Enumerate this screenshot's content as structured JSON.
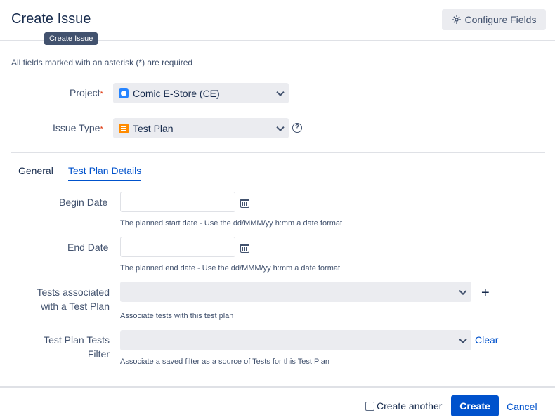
{
  "dialog": {
    "title": "Create Issue",
    "tooltip": "Create Issue",
    "configure_fields_label": "Configure Fields",
    "required_note": "All fields marked with an asterisk (*) are required"
  },
  "fields": {
    "project": {
      "label": "Project",
      "required_mark": "*",
      "value": "Comic E-Store (CE)",
      "icon": "project-avatar-icon"
    },
    "issue_type": {
      "label": "Issue Type",
      "required_mark": "*",
      "value": "Test Plan",
      "icon": "test-plan-icon",
      "help": "?"
    }
  },
  "tabs": [
    {
      "label": "General",
      "active": false
    },
    {
      "label": "Test Plan Details",
      "active": true
    }
  ],
  "details": {
    "begin_date": {
      "label": "Begin Date",
      "value": "",
      "hint": "The planned start date - Use the dd/MMM/yy h:mm a date format"
    },
    "end_date": {
      "label": "End Date",
      "value": "",
      "hint": "The planned end date - Use the dd/MMM/yy h:mm a date format"
    },
    "tests": {
      "label_line1": "Tests associated",
      "label_line2": "with a Test Plan",
      "hint": "Associate tests with this test plan",
      "add": "+"
    },
    "filter": {
      "label_line1": "Test Plan Tests",
      "label_line2": "Filter",
      "hint": "Associate a saved filter as a source of Tests for this Test Plan",
      "clear_label": "Clear"
    }
  },
  "footer": {
    "create_another_label": "Create another",
    "create_label": "Create",
    "cancel_label": "Cancel"
  },
  "colors": {
    "primary": "#0052cc",
    "text": "#172b4d",
    "subtle": "#42526e",
    "required": "#de350b",
    "field_bg": "#ebecf0"
  }
}
